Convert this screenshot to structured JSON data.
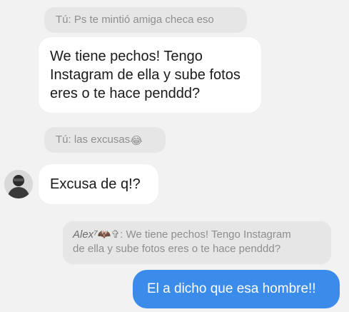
{
  "messages": {
    "reply_1": "Tú: Ps te mintió amiga checa eso",
    "incoming_1": {
      "lines": [
        "We tiene pechos! Tengo",
        "Instagram de ella y sube fotos",
        "eres o te hace penddd?"
      ]
    },
    "reply_2": {
      "text": "Tú: las excusas",
      "emoji": "😂"
    },
    "incoming_2": "Excusa de q!?",
    "reply_3": {
      "author": "Alex⁷",
      "author_emoji": "🦇✞",
      "line_1_rest": ": We tiene pechos! Tengo Instagram",
      "line_2": "de ella y sube fotos eres o te hace penddd?"
    },
    "outgoing_1": "El a dicho que esa hombre!!"
  },
  "icons": {
    "avatar": "avatar-person-icon"
  },
  "colors": {
    "background": "#f2f2f2",
    "reply_bg": "#e6e6e6",
    "incoming_bg": "#ffffff",
    "outgoing_bg": "#3b8bea"
  }
}
